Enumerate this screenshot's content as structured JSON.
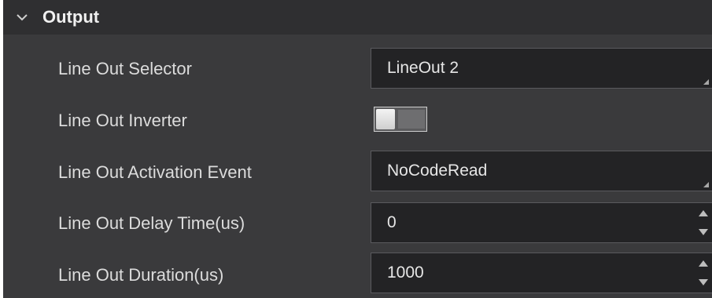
{
  "section": {
    "title": "Output"
  },
  "rows": {
    "line_out_selector": {
      "label": "Line Out Selector",
      "value": "LineOut 2"
    },
    "line_out_inverter": {
      "label": "Line Out Inverter",
      "state": "off"
    },
    "line_out_activation_event": {
      "label": "Line Out Activation Event",
      "value": "NoCodeRead"
    },
    "line_out_delay_time": {
      "label": "Line Out Delay Time(us)",
      "value": "0"
    },
    "line_out_duration": {
      "label": "Line Out Duration(us)",
      "value": "1000"
    }
  },
  "colors": {
    "panel_bg": "#3a3a3c",
    "header_bg": "#2f2f31",
    "field_bg": "#232325",
    "text": "#dcdcdc"
  },
  "icons": {
    "collapse": "chevron-down-icon",
    "spin_up": "triangle-up-icon",
    "spin_down": "triangle-down-icon"
  }
}
